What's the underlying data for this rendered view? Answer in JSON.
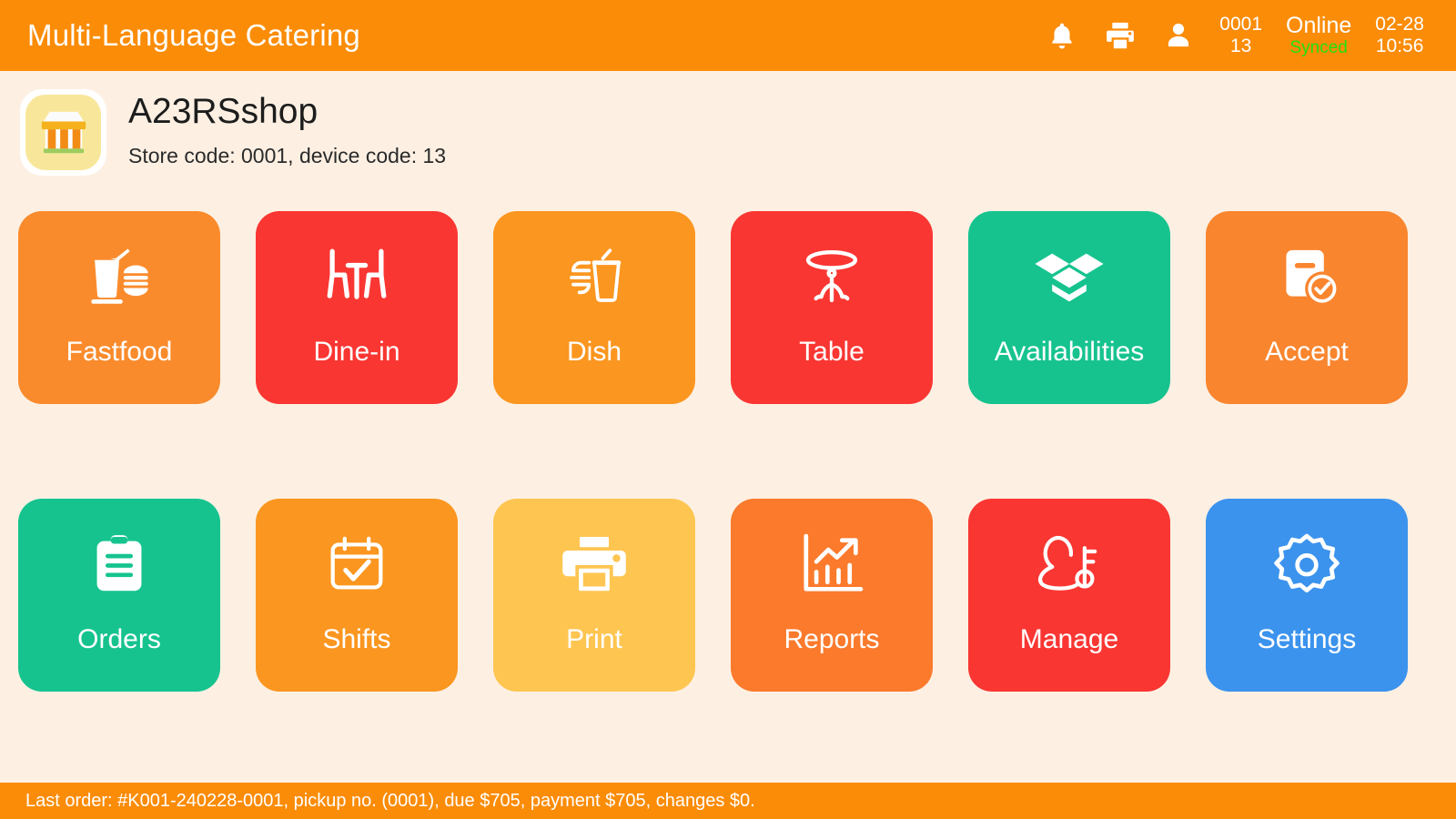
{
  "header": {
    "title": "Multi-Language Catering",
    "bg_color": "#fb8c07",
    "icons": [
      "bell-icon",
      "printer-icon",
      "person-icon"
    ],
    "store_code_line1": "0001",
    "store_code_line2": "13",
    "connection_status": "Online",
    "sync_status": "Synced",
    "sync_color": "#23e010",
    "date": "02-28",
    "time": "10:56"
  },
  "store": {
    "logo_icon": "storefront-icon",
    "name": "A23RSshop",
    "code_line": "Store code: 0001, device code: 13"
  },
  "tiles": [
    {
      "id": "fastfood",
      "label": "Fastfood",
      "icon": "drink-and-burger-icon",
      "color": "#fa8b2c"
    },
    {
      "id": "dine-in",
      "label": "Dine-in",
      "icon": "table-and-chairs-icon",
      "color": "#fa3632"
    },
    {
      "id": "dish",
      "label": "Dish",
      "icon": "burger-and-cup-icon",
      "color": "#fb9620"
    },
    {
      "id": "table",
      "label": "Table",
      "icon": "round-table-icon",
      "color": "#fa3632"
    },
    {
      "id": "availabilities",
      "label": "Availabilities",
      "icon": "open-box-icon",
      "color": "#16c38f"
    },
    {
      "id": "accept",
      "label": "Accept",
      "icon": "document-check-icon",
      "color": "#f9852f"
    },
    {
      "id": "orders",
      "label": "Orders",
      "icon": "clipboard-icon",
      "color": "#16c38f"
    },
    {
      "id": "shifts",
      "label": "Shifts",
      "icon": "calendar-check-icon",
      "color": "#fb9620"
    },
    {
      "id": "print",
      "label": "Print",
      "icon": "printer-icon",
      "color": "#fec551"
    },
    {
      "id": "reports",
      "label": "Reports",
      "icon": "bar-chart-trend-icon",
      "color": "#fb7a2c"
    },
    {
      "id": "manage",
      "label": "Manage",
      "icon": "person-key-icon",
      "color": "#fa3632"
    },
    {
      "id": "settings",
      "label": "Settings",
      "icon": "gear-icon",
      "color": "#3b93ed"
    }
  ],
  "footer": {
    "text": "Last order: #K001-240228-0001, pickup no. (0001), due $705, payment $705, changes $0.",
    "bg_color": "#fb8c07"
  },
  "page_background": "#fdf0e3"
}
